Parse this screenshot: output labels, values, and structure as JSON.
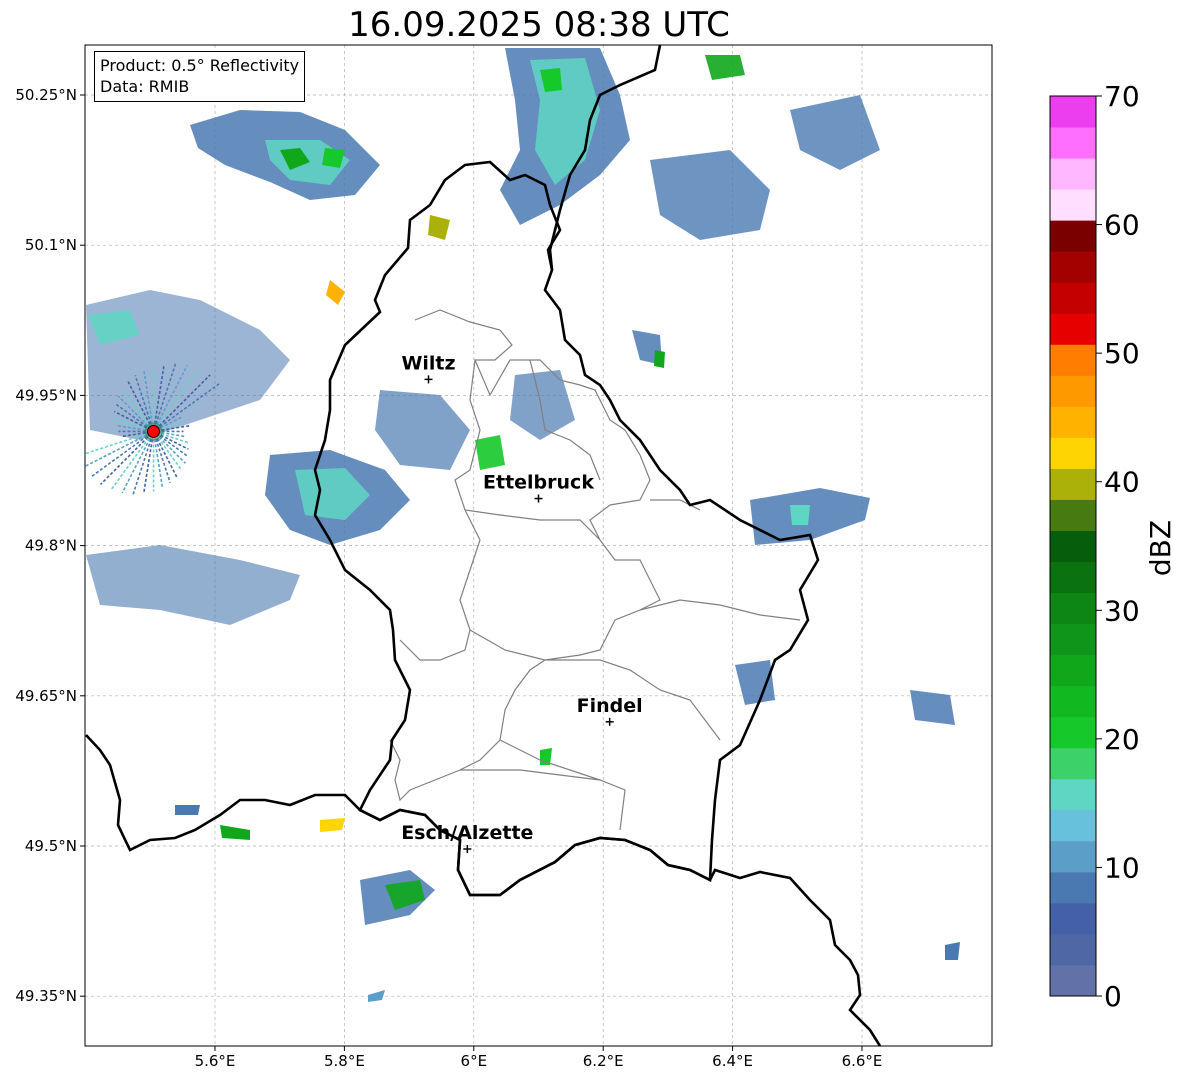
{
  "title": "16.09.2025 08:38 UTC",
  "info": {
    "product_line": "Product: 0.5° Reflectivity",
    "data_line": "Data: RMIB"
  },
  "axes": {
    "lon_range": [
      5.4,
      6.8
    ],
    "lat_range": [
      49.3,
      50.3
    ],
    "lon_ticks": [
      {
        "value": 5.6,
        "label": "5.6°E"
      },
      {
        "value": 5.8,
        "label": "5.8°E"
      },
      {
        "value": 6.0,
        "label": "6°E"
      },
      {
        "value": 6.2,
        "label": "6.2°E"
      },
      {
        "value": 6.4,
        "label": "6.4°E"
      },
      {
        "value": 6.6,
        "label": "6.6°E"
      }
    ],
    "lat_ticks": [
      {
        "value": 50.25,
        "label": "50.25°N"
      },
      {
        "value": 50.1,
        "label": "50.1°N"
      },
      {
        "value": 49.95,
        "label": "49.95°N"
      },
      {
        "value": 49.8,
        "label": "49.8°N"
      },
      {
        "value": 49.65,
        "label": "49.65°N"
      },
      {
        "value": 49.5,
        "label": "49.5°N"
      },
      {
        "value": 49.35,
        "label": "49.35°N"
      }
    ]
  },
  "cities": [
    {
      "name": "Wiltz",
      "lon": 5.93,
      "lat": 49.966
    },
    {
      "name": "Ettelbruck",
      "lon": 6.1,
      "lat": 49.847
    },
    {
      "name": "Findel",
      "lon": 6.21,
      "lat": 49.624
    },
    {
      "name": "Esch/Alzette",
      "lon": 5.99,
      "lat": 49.497
    }
  ],
  "radar_site": {
    "name": "radar-site",
    "lon": 5.505,
    "lat": 49.914,
    "color": "#ff0000"
  },
  "colorbar": {
    "label": "dBZ",
    "min": 0,
    "max": 70,
    "step": 2.5,
    "tick_values": [
      0,
      10,
      20,
      30,
      40,
      50,
      60,
      70
    ],
    "tick_labels": [
      "0",
      "10",
      "20",
      "30",
      "40",
      "50",
      "60",
      "70"
    ],
    "colors": [
      "#6272a8",
      "#4f67a5",
      "#4460a6",
      "#4a79b1",
      "#5b9ec7",
      "#67c0dc",
      "#5fd6c3",
      "#3dd16a",
      "#15c92a",
      "#12b820",
      "#10a71b",
      "#0f951a",
      "#0d8616",
      "#0a720e",
      "#065d0b",
      "#477a10",
      "#abb109",
      "#ffd500",
      "#ffb300",
      "#ff9900",
      "#ff7d00",
      "#e60000",
      "#c40000",
      "#a30000",
      "#7a0000",
      "#ffdeff",
      "#ffb8ff",
      "#ff6fff",
      "#ec3def"
    ]
  },
  "echo_samples": [
    {
      "lon": 5.52,
      "lat": 50.02,
      "dbz": 24
    },
    {
      "lon": 5.68,
      "lat": 50.18,
      "dbz": 22
    },
    {
      "lon": 5.75,
      "lat": 49.88,
      "dbz": 21
    },
    {
      "lon": 6.13,
      "lat": 50.18,
      "dbz": 18
    },
    {
      "lon": 5.84,
      "lat": 50.05,
      "dbz": 42
    },
    {
      "lon": 5.97,
      "lat": 49.45,
      "dbz": 24
    },
    {
      "lon": 6.11,
      "lat": 50.24,
      "dbz": 16
    },
    {
      "lon": 6.5,
      "lat": 49.82,
      "dbz": 14
    }
  ],
  "colors": {
    "country_border": "#000000",
    "canton_border": "#808080",
    "gridline": "#b0b0b0"
  }
}
